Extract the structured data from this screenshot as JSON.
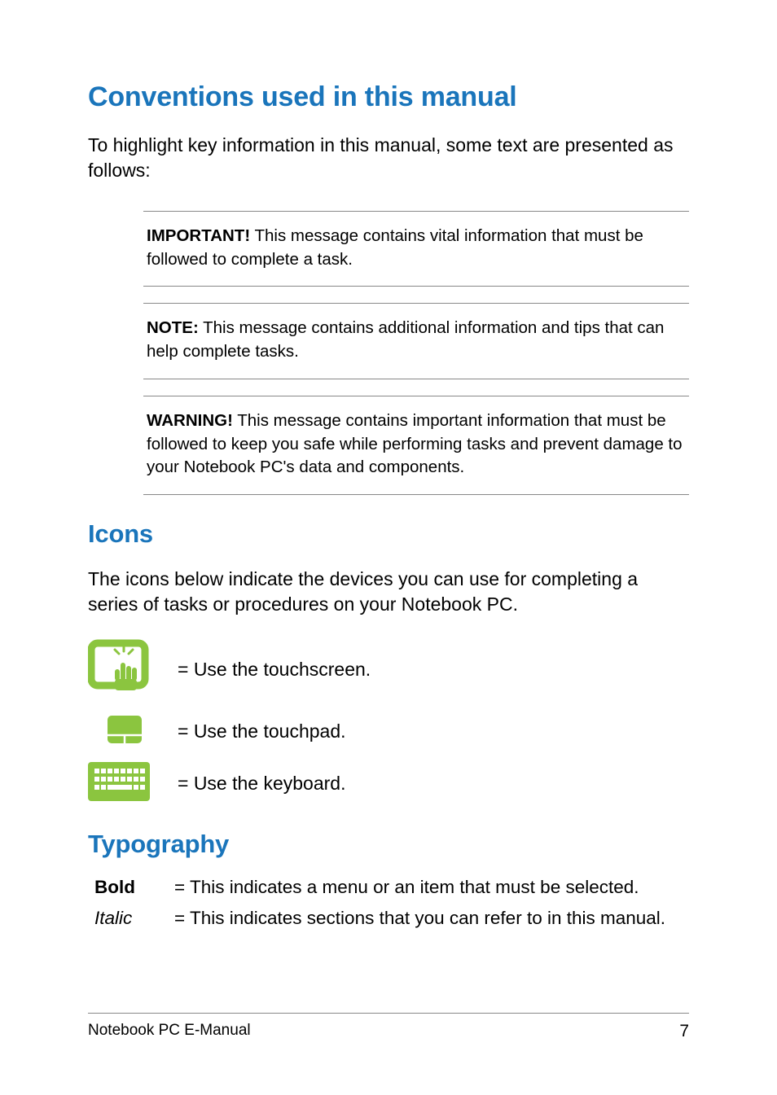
{
  "heading1": "Conventions used in this manual",
  "intro": "To highlight key information in this manual, some text are presented as follows:",
  "callouts": [
    {
      "label": "IMPORTANT!",
      "text": " This message contains vital information that must be followed to complete a task."
    },
    {
      "label": "NOTE:",
      "text": " This message contains additional information and tips that can help complete tasks."
    },
    {
      "label": "WARNING!",
      "text": " This message contains important information that must be followed to keep you safe while performing tasks and prevent damage to your Notebook PC's data and components."
    }
  ],
  "heading_icons": "Icons",
  "icons_intro": "The icons below indicate the devices you can use for completing a series of tasks or procedures on your Notebook PC.",
  "icons": [
    {
      "name": "touchscreen-icon",
      "desc": "= Use the touchscreen."
    },
    {
      "name": "touchpad-icon",
      "desc": "= Use the touchpad."
    },
    {
      "name": "keyboard-icon",
      "desc": "= Use the keyboard."
    }
  ],
  "heading_typo": "Typography",
  "typography": [
    {
      "term": "Bold",
      "style": "bold",
      "desc": "= This indicates a menu or an item that must be selected."
    },
    {
      "term": "Italic",
      "style": "italic",
      "desc": "= This indicates sections that you can refer to in this manual."
    }
  ],
  "footer_title": "Notebook PC E-Manual",
  "page_number": "7",
  "colors": {
    "accent": "#1a75bb",
    "icon_green": "#8bc53f"
  }
}
